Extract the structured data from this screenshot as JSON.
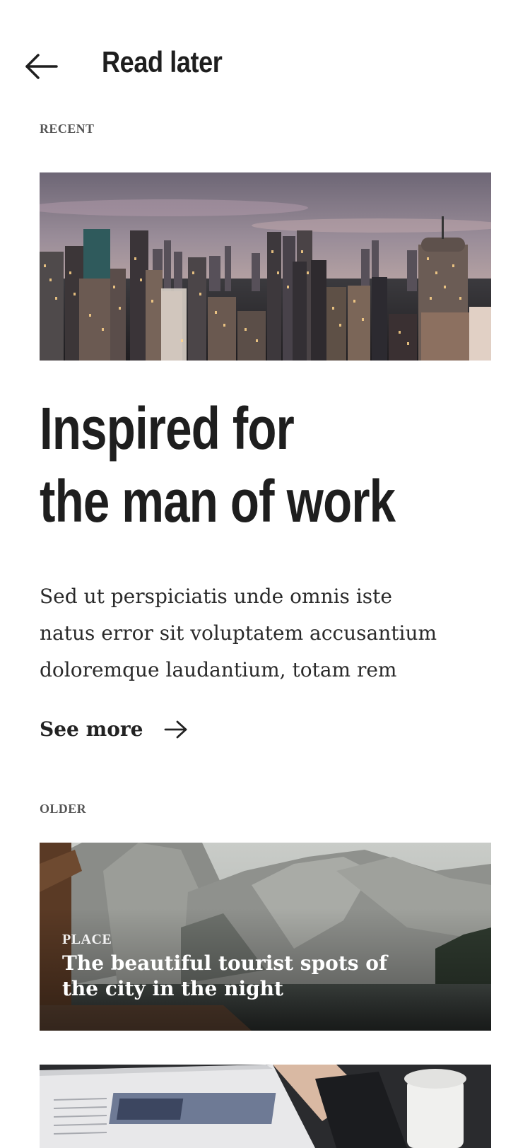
{
  "header": {
    "title": "Read later",
    "back_icon": "arrow-left-icon"
  },
  "recent": {
    "label": "RECENT",
    "image": "city-skyline-image",
    "title_line1": "Inspired for",
    "title_line2": "the man of work",
    "excerpt_lines": [
      "Sed ut perspiciatis unde omnis iste",
      "natus error sit voluptatem accusantium",
      "doloremque laudantium, totam rem"
    ],
    "see_more": "See more",
    "see_more_icon": "arrow-right-icon"
  },
  "older": {
    "label": "OLDER",
    "items": [
      {
        "image": "mountain-lake-image",
        "category": "PLACE",
        "title": "The beautiful tourist spots of the city in the night"
      },
      {
        "image": "newspaper-coffee-image"
      }
    ]
  },
  "colors": {
    "text": "#1e1e1e",
    "label": "#555555",
    "background": "#ffffff"
  }
}
